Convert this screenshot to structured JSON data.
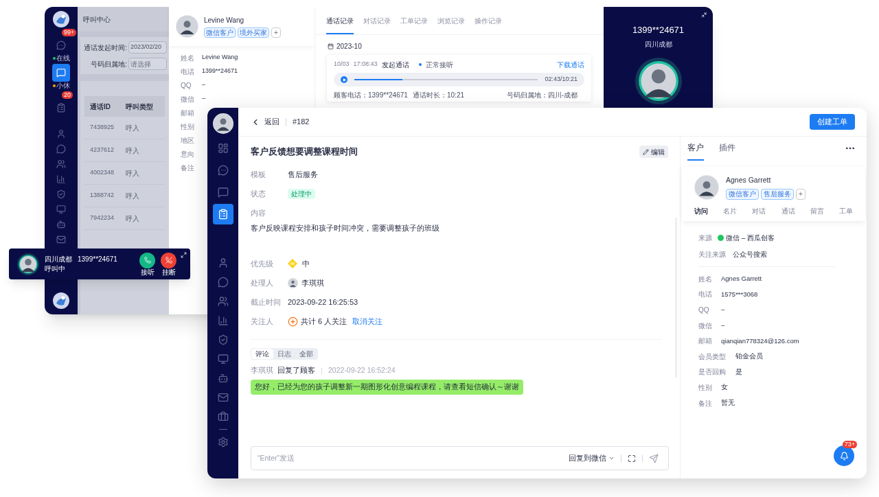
{
  "back_window": {
    "sidebar": {
      "top": [
        {
          "selected": false,
          "badge": "99+",
          "status": "在线",
          "color": "#22c55e"
        },
        {
          "selected": true,
          "status": "小休",
          "color": "#f59e0b"
        },
        {
          "selected": false,
          "badge": "20"
        }
      ],
      "bottom": [
        {
          "selected": false
        },
        {
          "selected": false
        },
        {
          "selected": false
        },
        {
          "selected": false
        },
        {
          "selected": false
        },
        {
          "selected": false
        },
        {
          "selected": false
        },
        {
          "selected": false
        }
      ]
    },
    "title": "呼叫中心",
    "filters": [
      {
        "label": "通话发起时间:",
        "value": "2023/02/20"
      },
      {
        "label": "号码归属地:",
        "placeholder": "请选择"
      }
    ],
    "table": {
      "columns": [
        "通话ID",
        "呼叫类型"
      ],
      "rows": [
        [
          "7438925",
          "呼入"
        ],
        [
          "4237612",
          "呼入"
        ],
        [
          "4002348",
          "呼入"
        ],
        [
          "1388742",
          "呼入"
        ],
        [
          "7942234",
          "呼入"
        ]
      ]
    },
    "customer": {
      "name": "Levine Wang",
      "tags": [
        "微信客户",
        "境外买家"
      ],
      "add": "+",
      "fields": [
        {
          "label": "姓名",
          "value": "Levine Wang"
        },
        {
          "label": "电话",
          "value": "1399**24671"
        },
        {
          "label": "QQ",
          "value": "–"
        },
        {
          "label": "微信",
          "value": "–"
        },
        {
          "label": "邮箱"
        },
        {
          "label": "性别"
        },
        {
          "label": "地区"
        },
        {
          "label": "意向"
        },
        {
          "label": "备注"
        }
      ]
    },
    "records": {
      "tabs": [
        {
          "label": "通话记录",
          "selected": true
        },
        {
          "label": "对话记录",
          "selected": false
        },
        {
          "label": "工单记录",
          "selected": false
        },
        {
          "label": "浏览记录",
          "selected": false
        },
        {
          "label": "操作记录",
          "selected": false
        }
      ],
      "month": "2023-10",
      "call": {
        "date": "10/03",
        "time": "17:08:43",
        "action": "发起通话",
        "status": "正常接听",
        "download": "下载通话",
        "level": 0.26,
        "reading": "02:43/10:21",
        "details": [
          "顾客电话：1399**24671",
          "通话时长：10:21",
          "号码归属地：四川-成都"
        ]
      }
    },
    "call_panel": {
      "number": "1399**24671",
      "location": "四川成都"
    }
  },
  "call_bar": {
    "location": "四川成都",
    "number": "1399**24671",
    "status": "呼叫中",
    "accept": "接听",
    "reject": "挂断"
  },
  "front_window": {
    "sidebar": {
      "top": [
        {
          "selected": false
        },
        {
          "selected": false
        },
        {
          "selected": false
        },
        {
          "selected": true
        }
      ],
      "bottom": [
        {
          "selected": false
        },
        {
          "selected": false
        },
        {
          "selected": false
        },
        {
          "selected": false
        },
        {
          "selected": false
        },
        {
          "selected": false
        },
        {
          "selected": false
        },
        {
          "selected": false
        },
        {
          "selected": false
        },
        {
          "selected": false
        }
      ]
    },
    "header": {
      "back": "返回",
      "ticket": "#182",
      "create_button": "创建工单"
    },
    "ticket": {
      "title": "客户反馈想要调整课程时间",
      "edit": "编辑",
      "template_label": "模板",
      "template": "售后服务",
      "status_label": "状态",
      "status": "处理中",
      "content_label": "内容",
      "content": "客户反映课程安排和孩子时间冲突，需要调整孩子的班级",
      "priority_label": "优先级",
      "priority": "中",
      "assignee_label": "处理人",
      "assignee": "李琪琪",
      "deadline_label": "截止时间",
      "deadline": "2023-09-22 16:25:53",
      "followers_label": "关注人",
      "followers": "共计 6 人关注",
      "unfollow": "取消关注"
    },
    "activity_tabs": [
      {
        "label": "评论",
        "selected": true
      },
      {
        "label": "日志",
        "selected": false
      },
      {
        "label": "全部",
        "selected": false
      }
    ],
    "comment": {
      "author": "李琪琪",
      "action": "回复了顾客",
      "time": "2022-09-22 16:52:24",
      "message": "您好，已经为您的孩子调整新一期图形化创意编程课程，请查看短信确认～谢谢"
    },
    "composer": {
      "placeholder": "“Enter”发送",
      "channel": "回复到微信"
    },
    "side_tabs": [
      {
        "label": "客户",
        "selected": true
      },
      {
        "label": "插件",
        "selected": false
      }
    ],
    "customer": {
      "name": "Agnes Garrett",
      "tags": [
        "微信客户",
        "售后服务"
      ],
      "add": "+",
      "tabs": [
        {
          "label": "访问",
          "selected": true
        },
        {
          "label": "名片",
          "selected": false
        },
        {
          "label": "对话",
          "selected": false
        },
        {
          "label": "通话",
          "selected": false
        },
        {
          "label": "留言",
          "selected": false
        },
        {
          "label": "工单",
          "selected": false
        }
      ],
      "source": [
        {
          "label": "来源",
          "value": "微信 – 西瓜创客"
        },
        {
          "label": "关注来源",
          "value": "公众号搜索"
        }
      ],
      "fields": [
        {
          "label": "姓名",
          "value": "Agnes Garrett"
        },
        {
          "label": "电话",
          "value": "1575***3068"
        },
        {
          "label": "QQ",
          "value": "–"
        },
        {
          "label": "微信",
          "value": "–"
        },
        {
          "label": "邮箱",
          "value": "qianqian778324@126.com"
        },
        {
          "label": "会员类型",
          "value": "铂金会员"
        },
        {
          "label": "是否回购",
          "value": "是"
        },
        {
          "label": "性别",
          "value": "女"
        },
        {
          "label": "备注",
          "value": "暂无"
        }
      ]
    },
    "notifications": "73+"
  }
}
